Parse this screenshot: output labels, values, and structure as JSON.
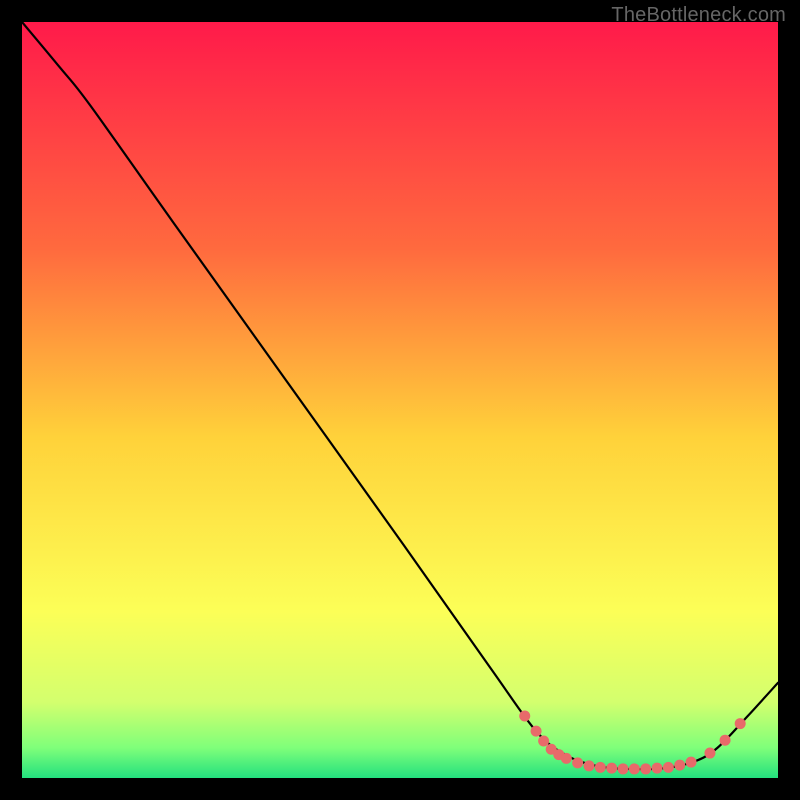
{
  "watermark": "TheBottleneck.com",
  "chart_data": {
    "type": "line",
    "title": "",
    "xlabel": "",
    "ylabel": "",
    "xlim": [
      0,
      100
    ],
    "ylim": [
      0,
      100
    ],
    "grid": false,
    "legend": false,
    "background_gradient": {
      "stops": [
        {
          "pos": 0.0,
          "color": "#ff1a4a"
        },
        {
          "pos": 0.3,
          "color": "#ff6a3e"
        },
        {
          "pos": 0.55,
          "color": "#ffd23a"
        },
        {
          "pos": 0.78,
          "color": "#fcff57"
        },
        {
          "pos": 0.9,
          "color": "#d3ff6e"
        },
        {
          "pos": 0.96,
          "color": "#7fff7a"
        },
        {
          "pos": 1.0,
          "color": "#23e07e"
        }
      ]
    },
    "series": [
      {
        "name": "curve",
        "color": "#000000",
        "width": 2.2,
        "points": [
          {
            "x": 0,
            "y": 100
          },
          {
            "x": 5,
            "y": 94
          },
          {
            "x": 9,
            "y": 89
          },
          {
            "x": 20,
            "y": 73.5
          },
          {
            "x": 35,
            "y": 52.5
          },
          {
            "x": 50,
            "y": 31.5
          },
          {
            "x": 62,
            "y": 14.5
          },
          {
            "x": 68,
            "y": 6.2
          },
          {
            "x": 72,
            "y": 3.0
          },
          {
            "x": 76,
            "y": 1.6
          },
          {
            "x": 80,
            "y": 1.2
          },
          {
            "x": 85,
            "y": 1.3
          },
          {
            "x": 89,
            "y": 2.2
          },
          {
            "x": 92,
            "y": 4.0
          },
          {
            "x": 96,
            "y": 8.2
          },
          {
            "x": 100,
            "y": 12.6
          }
        ]
      }
    ],
    "markers": {
      "color": "#e86a6a",
      "radius": 5.5,
      "points": [
        {
          "x": 66.5,
          "y": 8.2
        },
        {
          "x": 68.0,
          "y": 6.2
        },
        {
          "x": 69.0,
          "y": 4.9
        },
        {
          "x": 70.0,
          "y": 3.8
        },
        {
          "x": 71.0,
          "y": 3.1
        },
        {
          "x": 72.0,
          "y": 2.6
        },
        {
          "x": 73.5,
          "y": 2.0
        },
        {
          "x": 75.0,
          "y": 1.6
        },
        {
          "x": 76.5,
          "y": 1.4
        },
        {
          "x": 78.0,
          "y": 1.3
        },
        {
          "x": 79.5,
          "y": 1.2
        },
        {
          "x": 81.0,
          "y": 1.2
        },
        {
          "x": 82.5,
          "y": 1.2
        },
        {
          "x": 84.0,
          "y": 1.3
        },
        {
          "x": 85.5,
          "y": 1.4
        },
        {
          "x": 87.0,
          "y": 1.7
        },
        {
          "x": 88.5,
          "y": 2.1
        },
        {
          "x": 91.0,
          "y": 3.3
        },
        {
          "x": 93.0,
          "y": 5.0
        },
        {
          "x": 95.0,
          "y": 7.2
        }
      ]
    }
  }
}
